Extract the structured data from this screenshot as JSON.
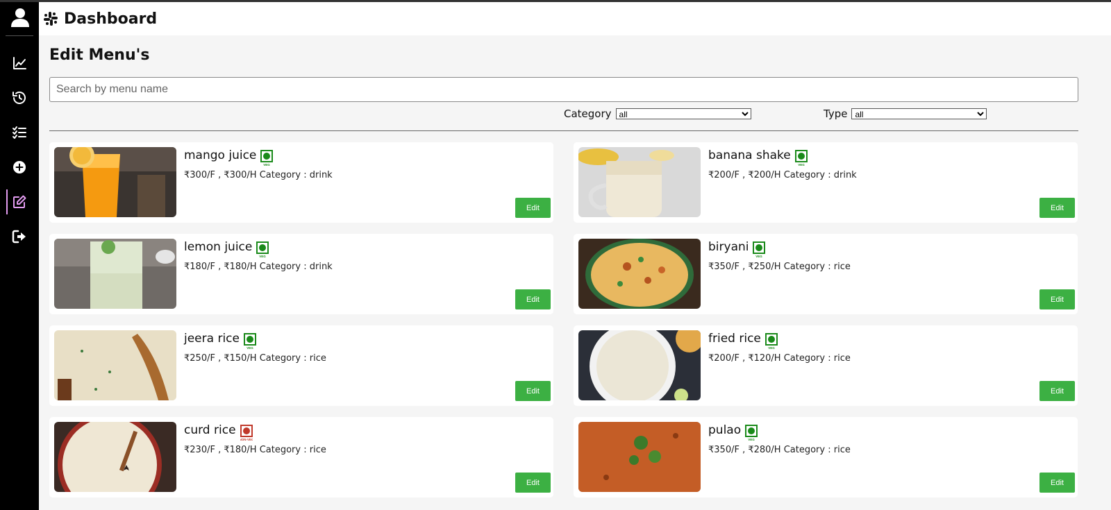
{
  "header": {
    "title": "Dashboard",
    "logo_icon": "slack-logo-icon"
  },
  "sidebar": {
    "avatar_icon": "user-icon",
    "items": [
      {
        "name": "analytics",
        "icon": "chart-line-icon",
        "active": false
      },
      {
        "name": "history",
        "icon": "history-icon",
        "active": false
      },
      {
        "name": "list",
        "icon": "checklist-icon",
        "active": false
      },
      {
        "name": "add",
        "icon": "plus-circle-icon",
        "active": false
      },
      {
        "name": "edit",
        "icon": "edit-icon",
        "active": true
      },
      {
        "name": "logout",
        "icon": "logout-icon",
        "active": false
      }
    ],
    "active_color": "#e39cf1"
  },
  "page": {
    "title": "Edit Menu's",
    "search": {
      "placeholder": "Search by menu name",
      "value": ""
    },
    "filters": {
      "category": {
        "label": "Category",
        "selected": "all"
      },
      "type": {
        "label": "Type",
        "selected": "all"
      }
    }
  },
  "menu": [
    {
      "name": "mango juice",
      "veg": true,
      "veg_label": "VEG",
      "meta": "₹300/F , ₹300/H Category : drink",
      "edit_label": "Edit"
    },
    {
      "name": "banana shake",
      "veg": true,
      "veg_label": "VEG",
      "meta": "₹200/F , ₹200/H Category : drink",
      "edit_label": "Edit"
    },
    {
      "name": "lemon juice",
      "veg": true,
      "veg_label": "VEG",
      "meta": "₹180/F , ₹180/H Category : drink",
      "edit_label": "Edit"
    },
    {
      "name": "biryani",
      "veg": true,
      "veg_label": "VEG",
      "meta": "₹350/F , ₹250/H Category : rice",
      "edit_label": "Edit"
    },
    {
      "name": "jeera rice",
      "veg": true,
      "veg_label": "VEG",
      "meta": "₹250/F , ₹150/H Category : rice",
      "edit_label": "Edit"
    },
    {
      "name": "fried rice",
      "veg": true,
      "veg_label": "VEG",
      "meta": "₹200/F , ₹120/H Category : rice",
      "edit_label": "Edit"
    },
    {
      "name": "curd rice",
      "veg": false,
      "veg_label": "NON-VEG",
      "meta": "₹230/F , ₹180/H Category : rice",
      "edit_label": "Edit"
    },
    {
      "name": "pulao",
      "veg": true,
      "veg_label": "VEG",
      "meta": "₹350/F , ₹280/H Category : rice",
      "edit_label": "Edit"
    }
  ],
  "colors": {
    "veg": "#1a8a1a",
    "nonveg": "#c0392b",
    "edit_button": "#3cb043"
  }
}
